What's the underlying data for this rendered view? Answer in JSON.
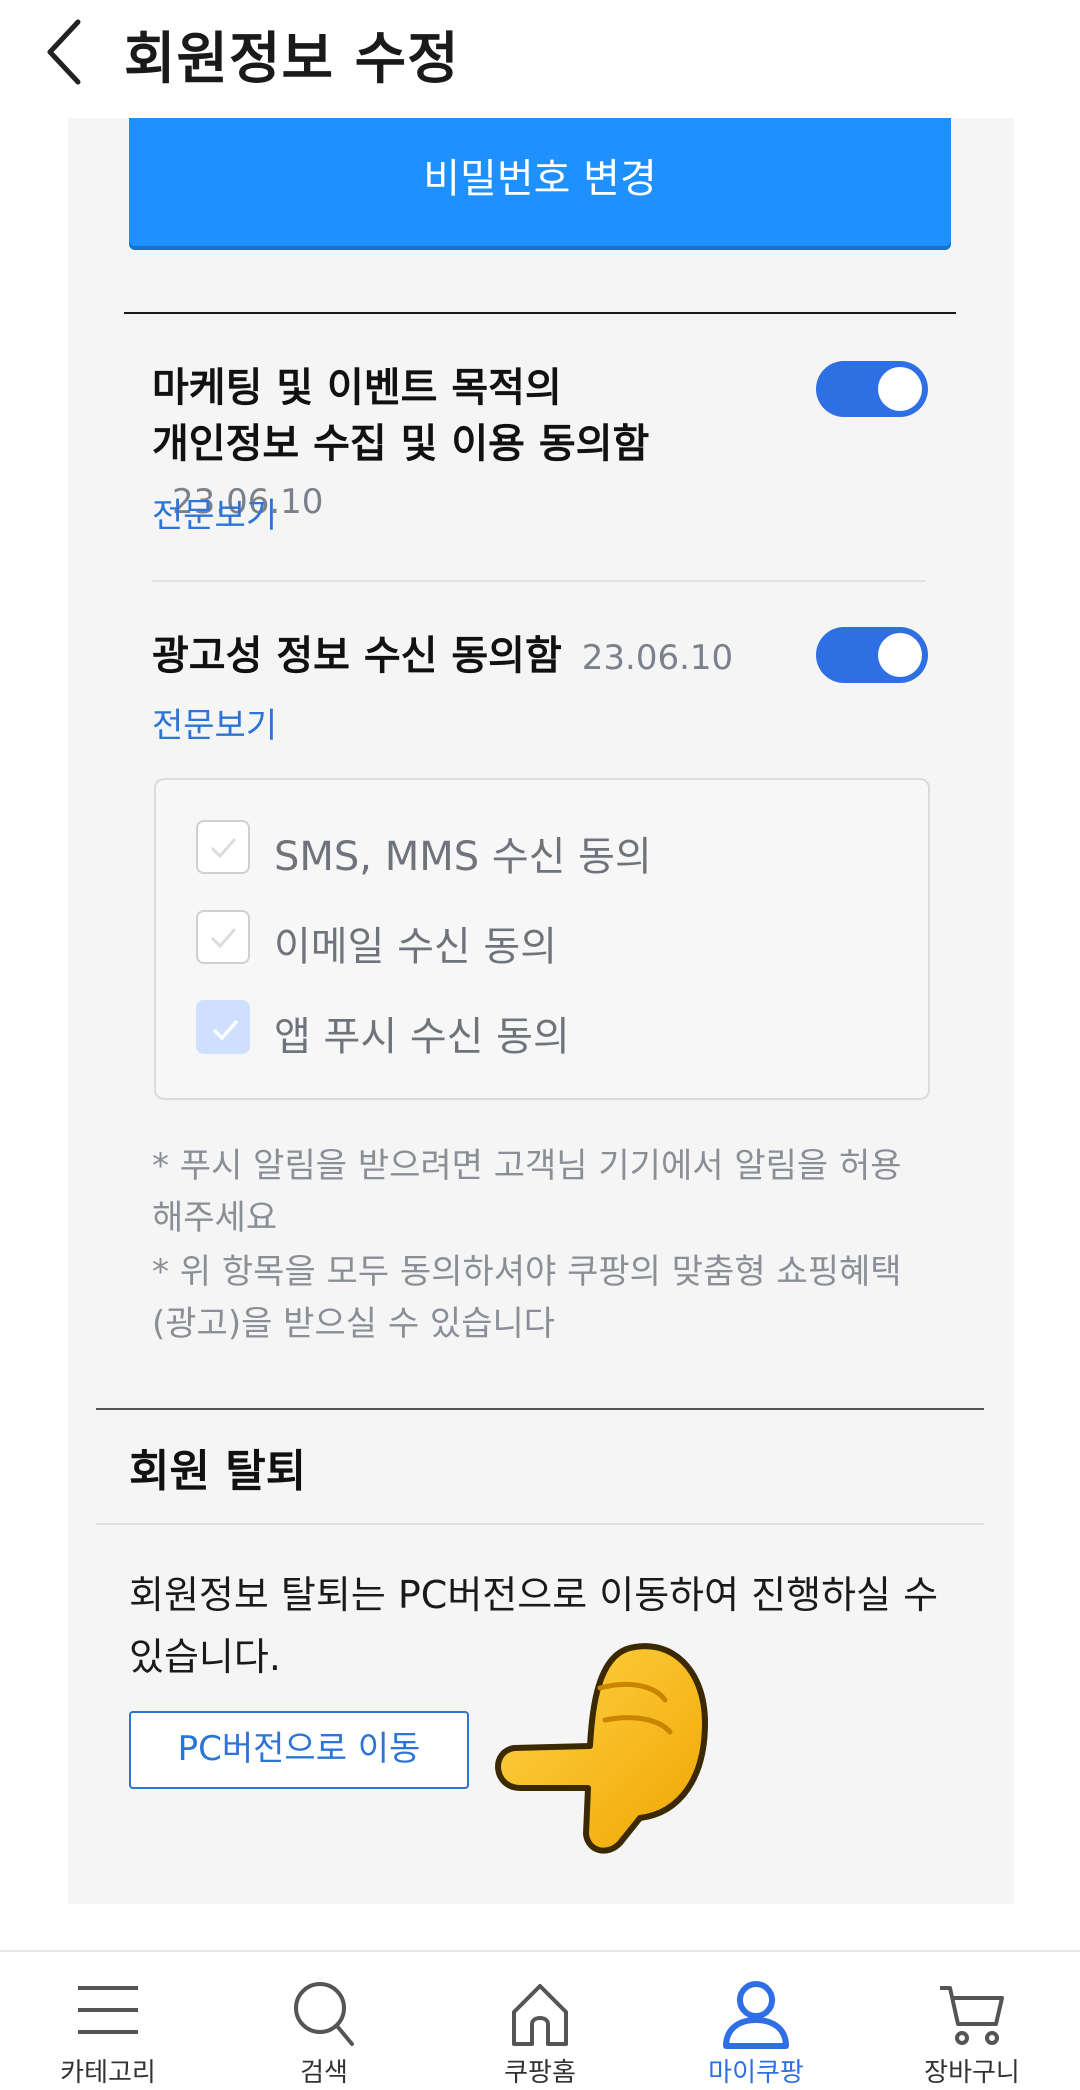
{
  "header": {
    "title": "회원정보 수정"
  },
  "password_button": {
    "label": "비밀번호 변경"
  },
  "consents": [
    {
      "title_line1": "마케팅 및 이벤트 목적의",
      "title_line2": "개인정보 수집 및 이용 동의함",
      "date": "23.06.10",
      "link": "전문보기",
      "enabled": true
    },
    {
      "title_line1": "광고성 정보 수신 동의함",
      "date": "23.06.10",
      "link": "전문보기",
      "enabled": true
    }
  ],
  "channels": [
    {
      "label": "SMS, MMS 수신 동의",
      "checked": false
    },
    {
      "label": "이메일 수신 동의",
      "checked": false
    },
    {
      "label": "앱 푸시 수신 동의",
      "checked": true
    }
  ],
  "notices": [
    "* 푸시 알림을 받으려면 고객님 기기에서 알림을 허용해주세요",
    "* 위 항목을 모두 동의하셔야 쿠팡의 맞춤형 쇼핑혜택 (광고)을 받으실 수 있습니다"
  ],
  "withdraw": {
    "title": "회원 탈퇴",
    "text": "회원정보 탈퇴는 PC버전으로 이동하여 진행하실 수 있습니다.",
    "button": "PC버전으로 이동"
  },
  "tabbar": [
    {
      "label": "카테고리",
      "icon": "menu-icon"
    },
    {
      "label": "검색",
      "icon": "search-icon"
    },
    {
      "label": "쿠팡홈",
      "icon": "home-icon"
    },
    {
      "label": "마이쿠팡",
      "icon": "user-icon",
      "active": true
    },
    {
      "label": "장바구니",
      "icon": "cart-icon"
    }
  ],
  "colors": {
    "primary_blue": "#1e90ff",
    "toggle_blue": "#2f6fe4",
    "link_blue": "#2c74d6",
    "panel_bg": "#f5f5f5"
  }
}
